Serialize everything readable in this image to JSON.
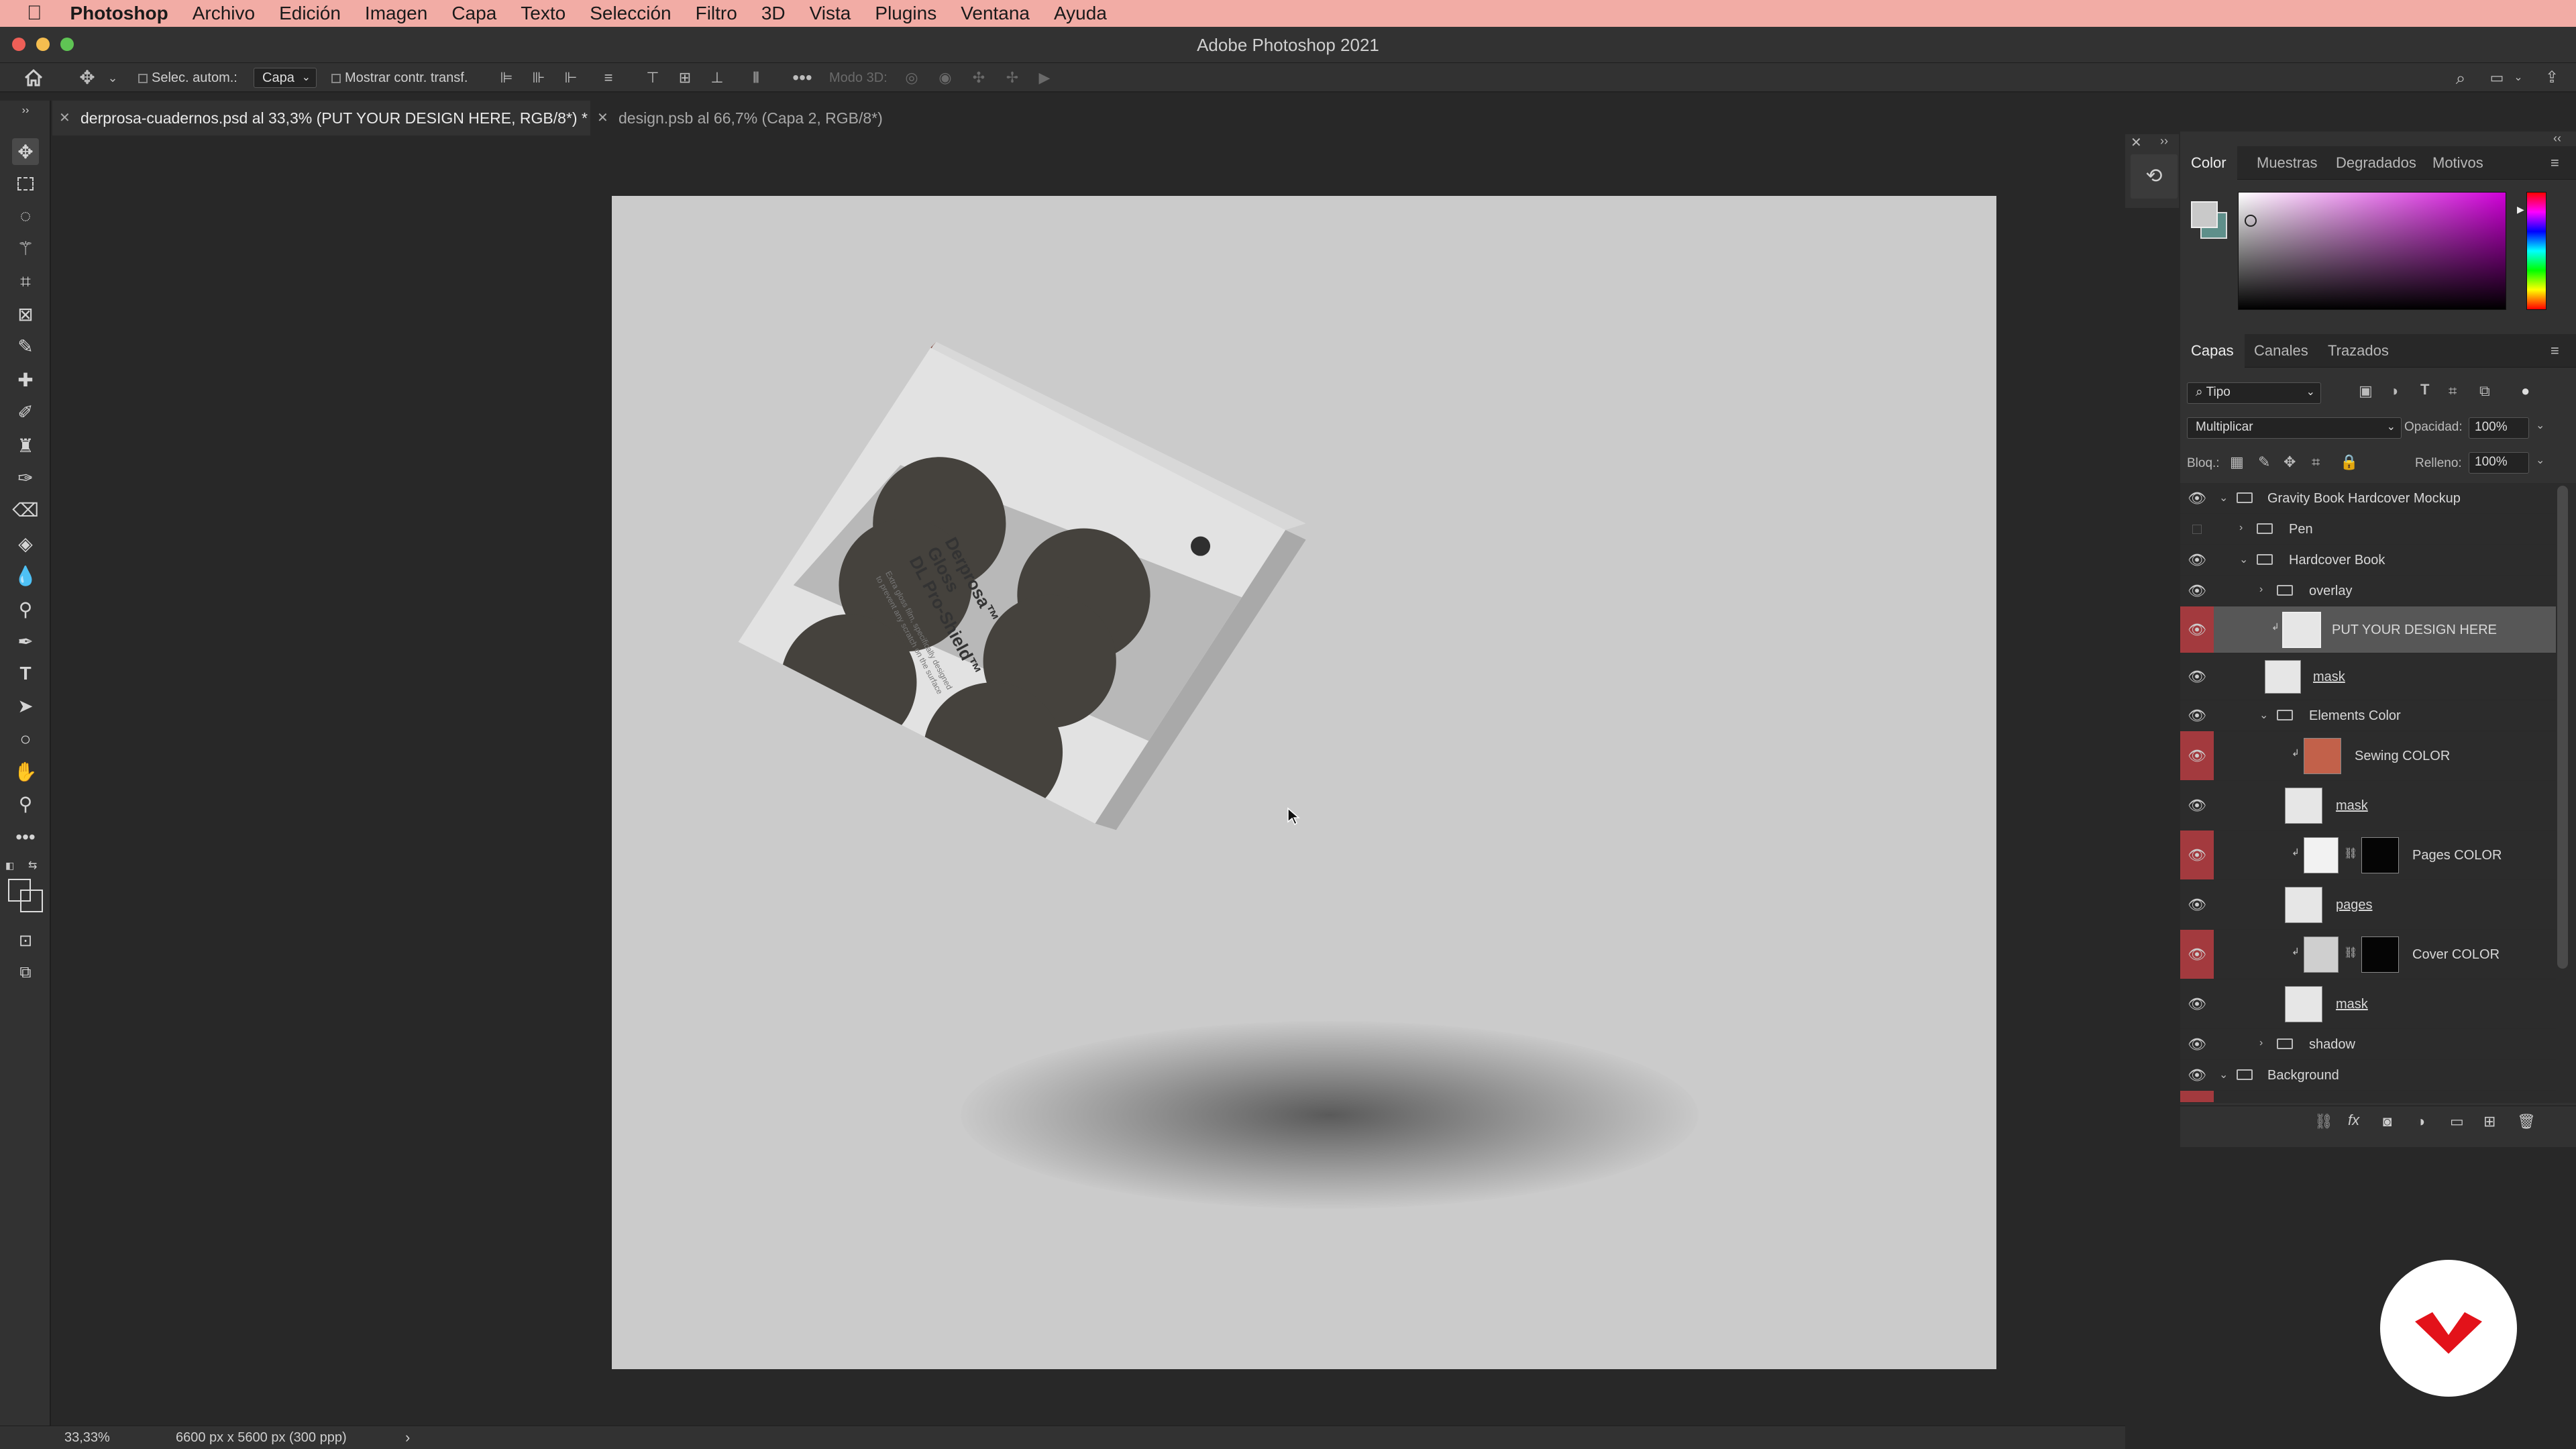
{
  "menubar": {
    "app_name": "Photoshop",
    "items": [
      "Archivo",
      "Edición",
      "Imagen",
      "Capa",
      "Texto",
      "Selección",
      "Filtro",
      "3D",
      "Vista",
      "Plugins",
      "Ventana",
      "Ayuda"
    ]
  },
  "window": {
    "title": "Adobe Photoshop 2021"
  },
  "options": {
    "auto_select_label": "Selec. autom.:",
    "auto_select_value": "Capa",
    "show_transform_label": "Mostrar contr. transf.",
    "mode3d_label": "Modo 3D:"
  },
  "tabs": [
    {
      "label": "derprosa-cuadernos.psd al 33,3% (PUT YOUR DESIGN HERE, RGB/8*) *",
      "active": true
    },
    {
      "label": "design.psb al 66,7% (Capa 2, RGB/8*)",
      "active": false
    }
  ],
  "status": {
    "zoom": "33,33%",
    "doc_info": "6600 px x 5600 px (300 ppp)"
  },
  "book": {
    "title_line1": "Derprosa™",
    "title_line2": "Gloss",
    "title_line3": "DL Pro-Shield™",
    "subtitle_line1": "Extra gloss film, specifically designed",
    "subtitle_line2": "to prevent any scratch on the surface"
  },
  "color_panel": {
    "tabs": [
      "Color",
      "Muestras",
      "Degradados",
      "Motivos"
    ],
    "active_tab": "Color",
    "foreground": "#c9c9c9",
    "background": "#5e8f8a"
  },
  "layers_panel": {
    "tabs": [
      "Capas",
      "Canales",
      "Trazados"
    ],
    "active_tab": "Capas",
    "filter_label": "Tipo",
    "blend_mode": "Multiplicar",
    "opacity_label": "Opacidad:",
    "opacity_value": "100%",
    "lock_label": "Bloq.:",
    "fill_label": "Relleno:",
    "fill_value": "100%",
    "layers": [
      {
        "name": "Gravity Book Hardcover Mockup",
        "type": "group",
        "visible": true
      },
      {
        "name": "Pen",
        "type": "group",
        "visible": false
      },
      {
        "name": "Hardcover Book",
        "type": "group",
        "visible": true
      },
      {
        "name": "overlay",
        "type": "group",
        "visible": true
      },
      {
        "name": "PUT YOUR DESIGN HERE",
        "type": "smart",
        "visible": true,
        "selected": true
      },
      {
        "name": "mask",
        "type": "layer",
        "visible": true
      },
      {
        "name": "Elements Color",
        "type": "group",
        "visible": true
      },
      {
        "name": "Sewing COLOR",
        "type": "fill",
        "visible": true,
        "color": "#c2614a"
      },
      {
        "name": "mask",
        "type": "layer",
        "visible": true
      },
      {
        "name": "Pages COLOR",
        "type": "fill-mask",
        "visible": true
      },
      {
        "name": "pages",
        "type": "layer",
        "visible": true
      },
      {
        "name": "Cover COLOR",
        "type": "fill-mask",
        "visible": true
      },
      {
        "name": "mask",
        "type": "layer",
        "visible": true
      },
      {
        "name": "shadow",
        "type": "group",
        "visible": true
      },
      {
        "name": "Background",
        "type": "group",
        "visible": true
      }
    ]
  }
}
